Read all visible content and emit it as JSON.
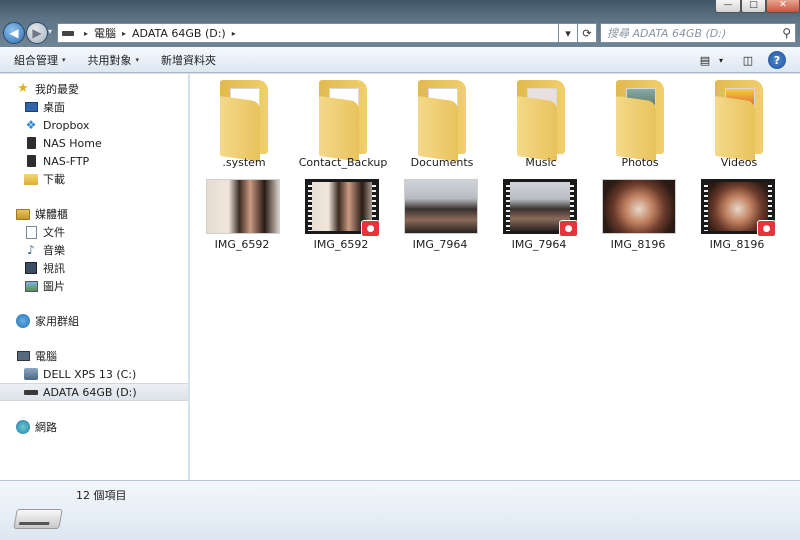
{
  "window": {
    "min_glyph": "—",
    "max_glyph": "□",
    "close_glyph": "✕"
  },
  "nav": {
    "back_glyph": "◀",
    "forward_glyph": "▶",
    "dropdown_glyph": "▾"
  },
  "address": {
    "crumbs": [
      "電腦",
      "ADATA 64GB (D:)"
    ],
    "sep_glyph": "▸",
    "history_glyph": "▾",
    "refresh_glyph": "⟳"
  },
  "search": {
    "placeholder": "搜尋 ADATA 64GB (D:)",
    "icon_glyph": "⚲"
  },
  "toolbar": {
    "organize": "組合管理",
    "share": "共用對象",
    "new_folder": "新增資料夾",
    "caret": "▾",
    "view_glyph": "▤",
    "view_caret": "▾",
    "pane_glyph": "◫",
    "help_glyph": "?"
  },
  "sidebar": {
    "favorites": {
      "label": "我的最愛",
      "items": [
        "桌面",
        "Dropbox",
        "NAS Home",
        "NAS-FTP",
        "下載"
      ]
    },
    "libraries": {
      "label": "媒體櫃",
      "items": [
        "文件",
        "音樂",
        "視訊",
        "圖片"
      ]
    },
    "homegroup": "家用群組",
    "computer": {
      "label": "電腦",
      "items": [
        "DELL XPS 13 (C:)",
        "ADATA 64GB (D:)"
      ],
      "selected": "ADATA 64GB (D:)"
    },
    "network": "網路"
  },
  "folders": [
    ".system",
    "Contact_Backup",
    "Documents",
    "Music",
    "Photos",
    "Videos"
  ],
  "files": [
    {
      "name": "IMG_6592",
      "kind": "image"
    },
    {
      "name": "IMG_6592",
      "kind": "video"
    },
    {
      "name": "IMG_7964",
      "kind": "image"
    },
    {
      "name": "IMG_7964",
      "kind": "video"
    },
    {
      "name": "IMG_8196",
      "kind": "image"
    },
    {
      "name": "IMG_8196",
      "kind": "video"
    }
  ],
  "status": {
    "item_count": "12 個項目"
  },
  "colors": {
    "title_gradient": "#5c7486",
    "video_badge": "#e8333a",
    "selection": "#dde3ea"
  }
}
